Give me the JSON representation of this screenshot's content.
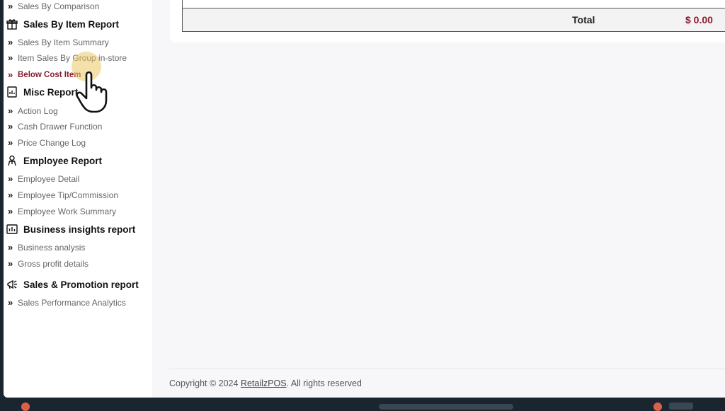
{
  "sidebar": {
    "sales_by_comparison": "Sales By Comparison",
    "sections": {
      "sales_by_item": {
        "title": "Sales By Item Report",
        "items": [
          "Sales By Item Summary",
          "Item Sales By Group in-store",
          "Below Cost Item"
        ]
      },
      "misc": {
        "title": "Misc Report",
        "items": [
          "Action Log",
          "Cash Drawer Function",
          "Price Change Log"
        ]
      },
      "employee": {
        "title": "Employee Report",
        "items": [
          "Employee Detail",
          "Employee Tip/Commission",
          "Employee Work Summary"
        ]
      },
      "business": {
        "title": "Business insights report",
        "items": [
          "Business analysis",
          "Gross profit details"
        ]
      },
      "promotion": {
        "title": "Sales & Promotion report",
        "items": [
          "Sales Performance Analytics"
        ]
      }
    },
    "active_item": "Below Cost Item"
  },
  "table": {
    "total_label": "Total",
    "total_value": "$ 0.00"
  },
  "footer": {
    "prefix": "Copyright © 2024",
    "link": "RetailzPOS",
    "suffix": ". All rights reserved"
  },
  "colors": {
    "accent": "#8b1c2f",
    "sidebar_bg": "#ffffff",
    "content_bg": "#f7f7f9"
  }
}
